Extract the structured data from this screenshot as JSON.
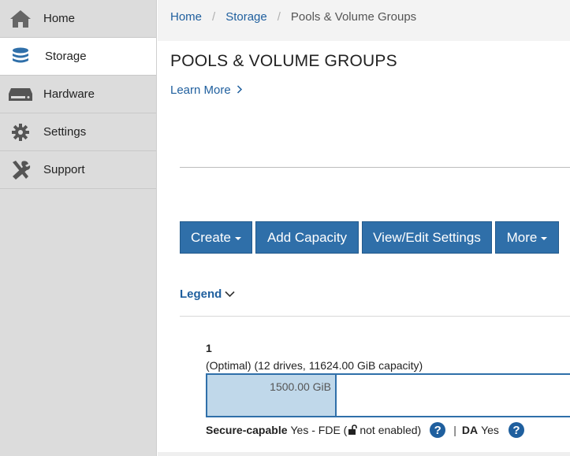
{
  "sidebar": {
    "items": [
      {
        "label": "Home",
        "icon": "home-icon"
      },
      {
        "label": "Storage",
        "icon": "database-icon",
        "active": true
      },
      {
        "label": "Hardware",
        "icon": "hardware-icon"
      },
      {
        "label": "Settings",
        "icon": "gear-icon"
      },
      {
        "label": "Support",
        "icon": "tools-icon"
      }
    ]
  },
  "breadcrumb": {
    "home": "Home",
    "storage": "Storage",
    "current": "Pools & Volume Groups",
    "separator": "/"
  },
  "page": {
    "title": "POOLS & VOLUME GROUPS",
    "learn_more": "Learn More"
  },
  "toolbar": {
    "create": "Create",
    "add_capacity": "Add Capacity",
    "view_edit": "View/Edit Settings",
    "more": "More"
  },
  "legend": {
    "label": "Legend"
  },
  "pool": {
    "name": "1",
    "status": "(Optimal) (12 drives, 11624.00 GiB capacity)",
    "used_label": "1500.00 GiB",
    "secure_label": "Secure-capable",
    "secure_value": "Yes - FDE (",
    "secure_suffix": "not enabled)",
    "separator": "|",
    "da_label": "DA",
    "da_value": "Yes",
    "help_glyph": "?"
  },
  "colors": {
    "accent": "#2f6fa9",
    "link": "#1f5f9e",
    "sidebar_bg": "#dcdcdc",
    "used_fill": "#c0d8ea"
  }
}
